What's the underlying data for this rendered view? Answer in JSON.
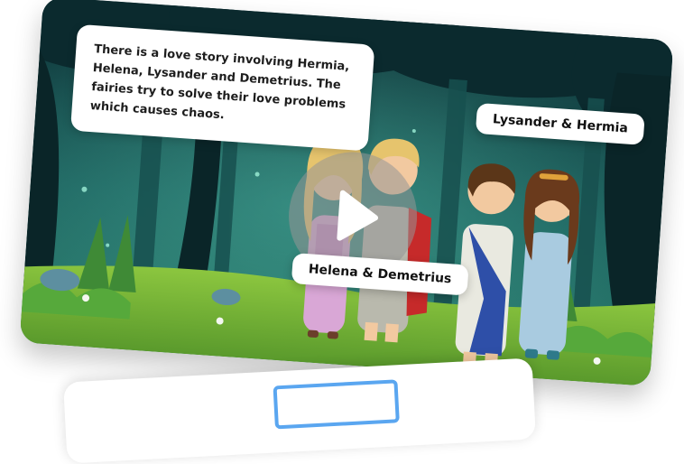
{
  "story": {
    "caption": "There is a love story involving Hermia, Helena, Lysander and Demetrius. The fairies try to solve their love problems which causes chaos.",
    "tags": {
      "lysander_hermia": "Lysander & Hermia",
      "helena_demetrius": "Helena & Demetrius"
    }
  },
  "video": {
    "play_icon": "play-icon"
  },
  "colors": {
    "forest_dark": "#0f3a3f",
    "forest_mid": "#1f6e68",
    "grass": "#7dbd3a",
    "play_overlay": "#969696",
    "accent_blue": "#5aa6f0"
  }
}
